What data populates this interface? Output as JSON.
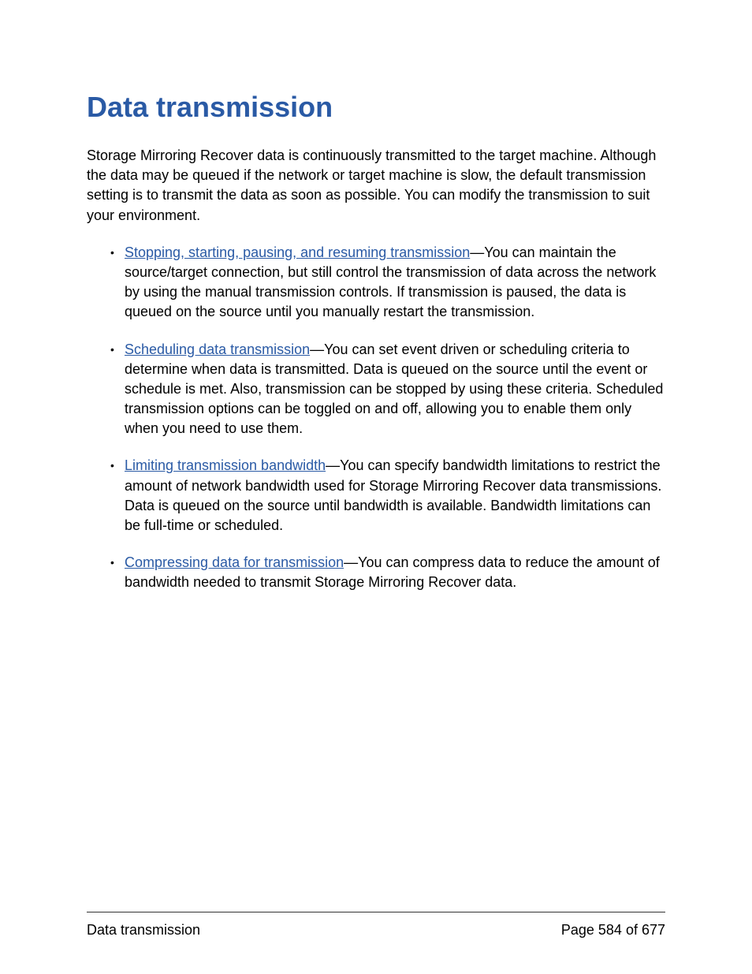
{
  "heading": "Data transmission",
  "intro": "Storage Mirroring Recover data is continuously transmitted to the target machine. Although the data may be queued if the network or target machine is slow, the default transmission setting is to transmit the data as soon as possible. You can modify the transmission to suit your environment.",
  "items": [
    {
      "link": "Stopping, starting, pausing, and resuming transmission",
      "text": "—You can maintain the source/target connection, but still control the transmission of data across the network by using the manual transmission controls. If transmission is paused, the data is queued on the source until you manually restart the transmission."
    },
    {
      "link": "Scheduling data transmission",
      "text": "—You can set event driven or scheduling criteria to determine when data is transmitted. Data is queued on the source until the event or schedule is met. Also, transmission can be stopped by using these criteria. Scheduled transmission options can be toggled on and off, allowing you to enable them only when you need to use them."
    },
    {
      "link": "Limiting transmission bandwidth",
      "text": "—You can specify bandwidth limitations to restrict the amount of network bandwidth used for Storage Mirroring Recover data transmissions. Data is queued on the source until bandwidth is available. Bandwidth limitations can be full-time or scheduled."
    },
    {
      "link": "Compressing data for transmission",
      "text": "—You can compress data to reduce the amount of bandwidth needed to transmit Storage Mirroring Recover data."
    }
  ],
  "footer": {
    "left": "Data transmission",
    "right": "Page 584 of 677"
  }
}
